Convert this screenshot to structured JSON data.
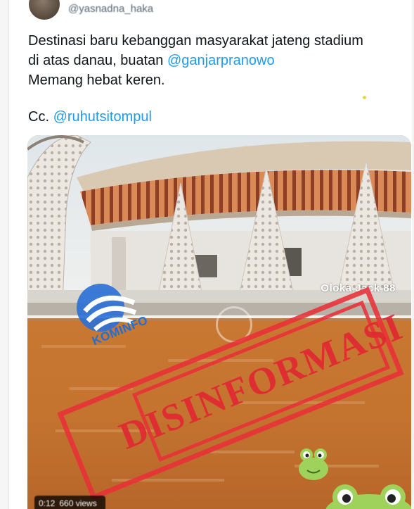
{
  "tweet": {
    "handle": "@yasnadna_haka",
    "text_lines": [
      "Destinasi baru kebanggan masyarakat jateng stadium",
      "di atas danau, buatan "
    ],
    "mention_1": "@ganjarpranowo",
    "text_line_3": "Memang hebat keren.",
    "cc_label": "Cc. ",
    "mention_2": "@ruhutsitompul"
  },
  "media": {
    "watermark": "Oloka Jack 88",
    "stamp_text": "DISINFORMASI",
    "logo_text": "KOMINFO",
    "video_time": "0:12",
    "video_views": "660 views"
  },
  "colors": {
    "mention": "#1d9bf0",
    "stamp_red": "#e83038",
    "water": "#c7793a"
  }
}
